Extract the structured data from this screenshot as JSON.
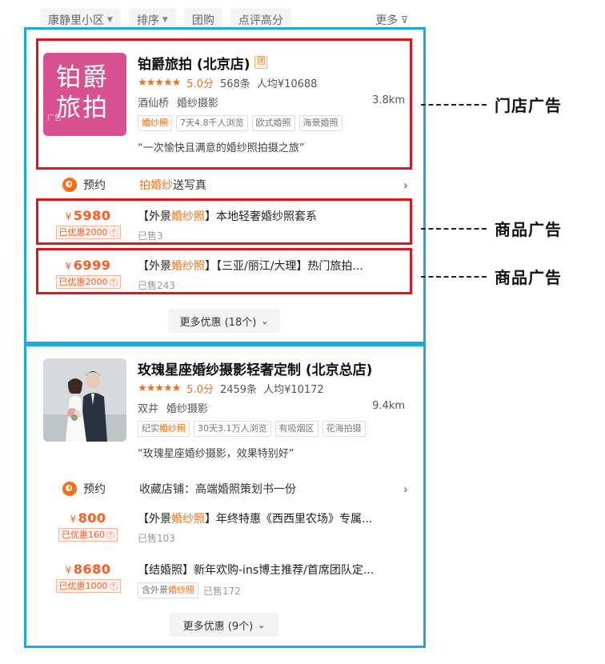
{
  "filter_bar": {
    "chips": [
      "康静里小区",
      "排序",
      "团购",
      "点评高分"
    ],
    "more_label": "更多"
  },
  "annotations": {
    "shop_ad": "门店广告",
    "product_ad_1": "商品广告",
    "product_ad_2": "商品广告"
  },
  "shop1": {
    "logo_line1": "铂爵",
    "logo_line2": "旅拍",
    "ad_mark": "广告",
    "name": "铂爵旅拍 (北京店)",
    "badge": "团",
    "stars": "★★★★★",
    "score": "5.0分",
    "reviews": "568条",
    "avg_price": "人均¥10688",
    "area": "酒仙桥",
    "category": "婚纱摄影",
    "distance": "3.8km",
    "tags": [
      {
        "pre": "",
        "hl": "婚纱照",
        "post": ""
      },
      {
        "pre": "7天4.8千人浏览",
        "hl": "",
        "post": ""
      },
      {
        "pre": "欧式婚照",
        "hl": "",
        "post": ""
      },
      {
        "pre": "海景婚照",
        "hl": "",
        "post": ""
      }
    ],
    "quote": "“一次愉快且满意的婚纱照拍摄之旅”",
    "booking": {
      "label": "预约",
      "text_hl": "拍婚纱",
      "text_rest": "送写真"
    },
    "products": [
      {
        "currency": "¥",
        "price": "5980",
        "discount": "已优惠2000",
        "title_pre": "【外景",
        "title_hl": "婚纱照",
        "title_post": "】本地轻奢婚纱照套系",
        "tag": "",
        "sold": "已售3"
      },
      {
        "currency": "¥",
        "price": "6999",
        "discount": "已优惠2000",
        "title_pre": "【外景",
        "title_hl": "婚纱照",
        "title_post": "】【三亚/丽江/大理】热门旅拍...",
        "tag": "",
        "sold": "已售243"
      }
    ],
    "more_button": "更多优惠 (18个)"
  },
  "shop2": {
    "name": "玫瑰星座婚纱摄影轻奢定制 (北京总店)",
    "stars": "★★★★★",
    "score": "5.0分",
    "reviews": "2459条",
    "avg_price": "人均¥10172",
    "area": "双井",
    "category": "婚纱摄影",
    "distance": "9.4km",
    "tags": [
      {
        "pre": "纪实",
        "hl": "婚纱照",
        "post": ""
      },
      {
        "pre": "30天3.1万人浏览",
        "hl": "",
        "post": ""
      },
      {
        "pre": "有吸烟区",
        "hl": "",
        "post": ""
      },
      {
        "pre": "花海拍摄",
        "hl": "",
        "post": ""
      }
    ],
    "quote": "“玫瑰星座婚纱摄影，效果特别好”",
    "booking": {
      "label": "预约",
      "text_hl": "",
      "text_rest": "收藏店铺：高端婚照策划书一份"
    },
    "products": [
      {
        "currency": "¥",
        "price": "800",
        "discount": "已优惠160",
        "title_pre": "【外景",
        "title_hl": "婚纱照",
        "title_post": "】年终特惠《西西里农场》专属...",
        "tag": "",
        "sold": "已售103"
      },
      {
        "currency": "¥",
        "price": "8680",
        "discount": "已优惠1000",
        "title_pre": "【结婚照】新年欢购-ins博主推荐/首席团队定...",
        "title_hl": "",
        "title_post": "",
        "tag_pre": "含外景",
        "tag_hl": "婚纱照",
        "sold": "已售172"
      }
    ],
    "more_button": "更多优惠 (9个)"
  },
  "colors": {
    "card_border": "#1aa9e2",
    "ad_box_border": "#e0141a",
    "accent": "#ff6d12",
    "logo_bg": "#d8508f"
  }
}
